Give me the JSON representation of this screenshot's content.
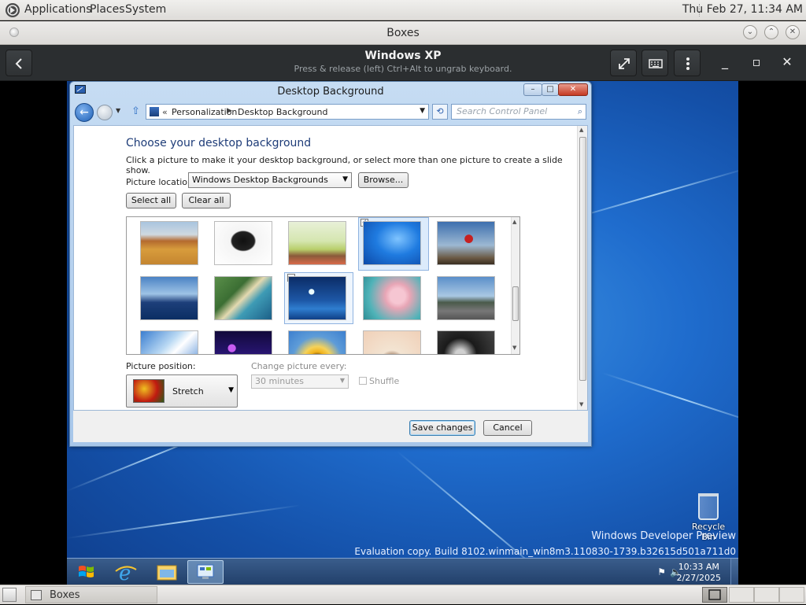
{
  "gnome_panel": {
    "menus": [
      "Applications",
      "Places",
      "System"
    ],
    "clock": "Thu Feb 27, 11:34 AM"
  },
  "boxes": {
    "window_title": "Boxes",
    "vm_title": "Windows XP",
    "vm_hint": "Press & release (left) Ctrl+Alt to ungrab keyboard."
  },
  "dialog": {
    "title": "Desktop Background",
    "breadcrumb": [
      "Personalization",
      "Desktop Background"
    ],
    "search_placeholder": "Search Control Panel",
    "heading": "Choose your desktop background",
    "description": "Click a picture to make it your desktop background, or select more than one picture to create a slide show.",
    "picture_location_label": "Picture location:",
    "picture_location_value": "Windows Desktop Backgrounds",
    "browse_label": "Browse...",
    "select_all_label": "Select all",
    "clear_all_label": "Clear all",
    "thumbnails": [
      {
        "name": "farm",
        "selected": false
      },
      {
        "name": "dog",
        "selected": false
      },
      {
        "name": "trees",
        "selected": false
      },
      {
        "name": "windows-logo",
        "selected": true
      },
      {
        "name": "balloon",
        "selected": false
      },
      {
        "name": "lake",
        "selected": false
      },
      {
        "name": "coast",
        "selected": false
      },
      {
        "name": "lighthouse",
        "selected": false
      },
      {
        "name": "flower",
        "selected": false
      },
      {
        "name": "railway",
        "selected": false
      },
      {
        "name": "bridge",
        "selected": false
      },
      {
        "name": "fireworks",
        "selected": false
      },
      {
        "name": "sunflower",
        "selected": false
      },
      {
        "name": "bird",
        "selected": false
      },
      {
        "name": "record",
        "selected": false
      }
    ],
    "picture_position_label": "Picture position:",
    "picture_position_value": "Stretch",
    "change_every_label": "Change picture every:",
    "change_every_value": "30 minutes",
    "shuffle_label": "Shuffle",
    "save_label": "Save changes",
    "cancel_label": "Cancel"
  },
  "desktop": {
    "recycle_bin_label": "Recycle Bin",
    "watermark_line1": "Windows Developer Preview",
    "watermark_line2": "Evaluation copy. Build 8102.winmain_win8m3.110830-1739.b32615d501a711d0"
  },
  "taskbar": {
    "time": "10:33 AM",
    "date": "2/27/2025"
  },
  "gnome_bottom": {
    "task_label": "Boxes"
  },
  "colors": {
    "win_accent": "#1f6ccd",
    "dialog_heading": "#1e3c78",
    "boxes_header": "#2b2e30"
  }
}
